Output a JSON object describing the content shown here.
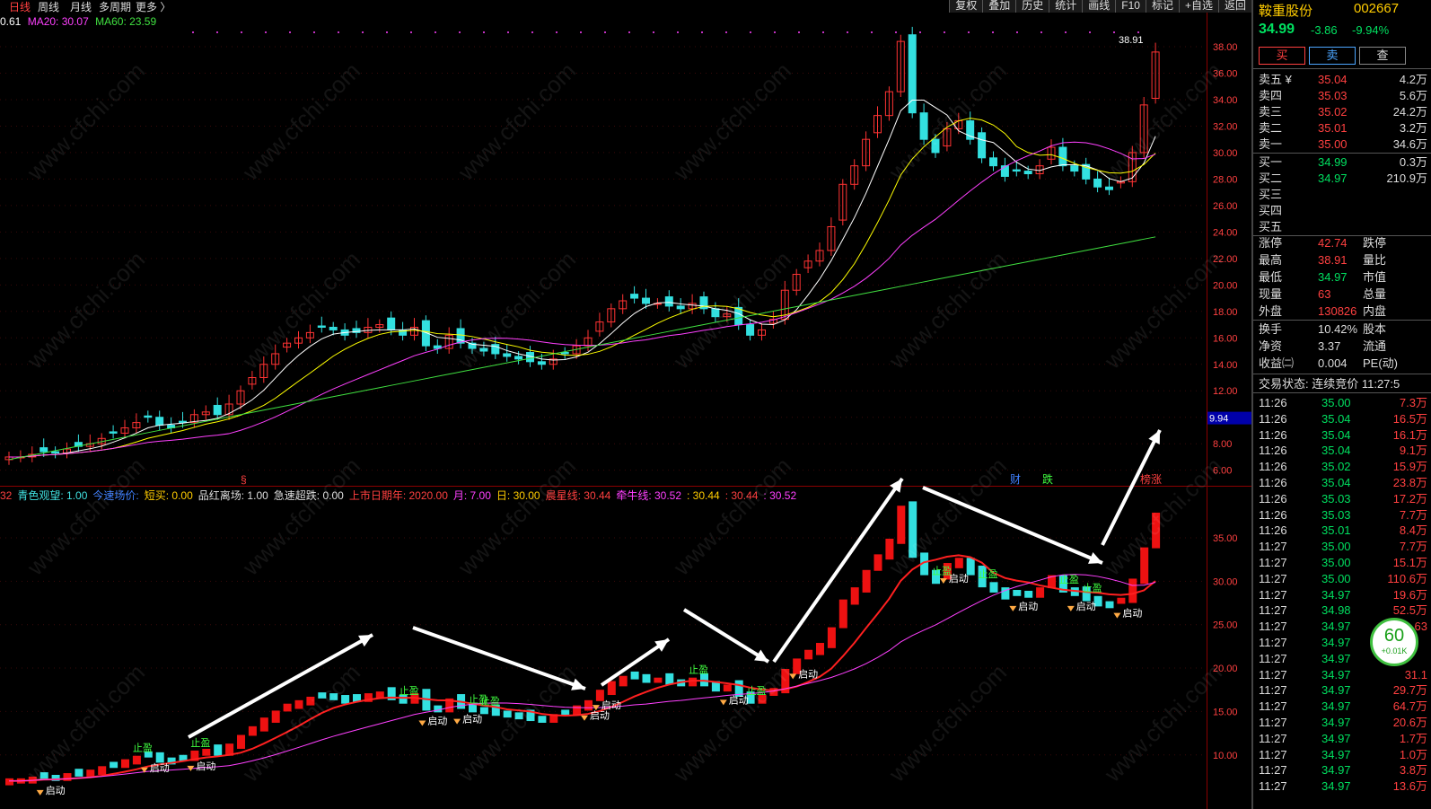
{
  "toolbar": {
    "left": [
      "日线",
      "周线",
      "月线",
      "多周期",
      "更多 〉"
    ],
    "right": [
      "复权",
      "叠加",
      "历史",
      "统计",
      "画线",
      "F10",
      "标记",
      "+自选",
      "返回"
    ]
  },
  "ma_legend": {
    "ma5": "0.61",
    "ma20": "MA20: 30.07",
    "ma60": "MA60: 23.59"
  },
  "indicator_legend": [
    {
      "text": "32",
      "color": "#ff4040"
    },
    {
      "text": "青色观望: 1.00",
      "color": "#40e0e0"
    },
    {
      "text": "今速场价:",
      "color": "#4080ff"
    },
    {
      "text": "短买: 0.00",
      "color": "#ffcc00"
    },
    {
      "text": "品红离场: 1.00",
      "color": "#dddddd"
    },
    {
      "text": "急速超跌: 0.00",
      "color": "#dddddd"
    },
    {
      "text": "上市日期年: 2020.00",
      "color": "#ff4040"
    },
    {
      "text": "月: 7.00",
      "color": "#ff40ff"
    },
    {
      "text": "日: 30.00",
      "color": "#ffcc00"
    },
    {
      "text": "晨星线: 30.44",
      "color": "#ff4040"
    },
    {
      "text": "牵牛线: 30.52",
      "color": "#ff40ff"
    },
    {
      "text": ": 30.44",
      "color": "#ffcc00"
    },
    {
      "text": ": 30.44",
      "color": "#ff4040"
    },
    {
      "text": ": 30.52",
      "color": "#ff40ff"
    }
  ],
  "price_axis": [
    "38.00",
    "36.00",
    "34.00",
    "32.00",
    "30.00",
    "28.00",
    "26.00",
    "24.00",
    "22.00",
    "20.00",
    "18.00",
    "16.00",
    "14.00",
    "12.00",
    "10.00",
    "8.00",
    "6.00"
  ],
  "price_axis_highlight": "9.94",
  "sub_axis": [
    "35.00",
    "30.00",
    "25.00",
    "20.00",
    "15.00",
    "10.00"
  ],
  "high_label": "38.91",
  "bottom_tags": [
    {
      "text": "财",
      "color": "#4080ff"
    },
    {
      "text": "跌",
      "color": "#40ff40"
    },
    {
      "text": "榜涨",
      "color": "#ff4040"
    }
  ],
  "signals": {
    "stop": "止盈",
    "start": "启动"
  },
  "panel": {
    "name": "鞍重股份",
    "code": "002667",
    "price": "34.99",
    "change": "-3.86",
    "pct": "-9.94%",
    "buttons": [
      "买",
      "卖",
      "查"
    ],
    "asks": [
      {
        "label": "卖五 ¥",
        "price": "35.04",
        "vol": "4.2万"
      },
      {
        "label": "卖四",
        "price": "35.03",
        "vol": "5.6万"
      },
      {
        "label": "卖三",
        "price": "35.02",
        "vol": "24.2万"
      },
      {
        "label": "卖二",
        "price": "35.01",
        "vol": "3.2万"
      },
      {
        "label": "卖一",
        "price": "35.00",
        "vol": "34.6万"
      }
    ],
    "bids": [
      {
        "label": "买一",
        "price": "34.99",
        "vol": "0.3万"
      },
      {
        "label": "买二",
        "price": "34.97",
        "vol": "210.9万"
      },
      {
        "label": "买三",
        "price": "",
        "vol": ""
      },
      {
        "label": "买四",
        "price": "",
        "vol": ""
      },
      {
        "label": "买五",
        "price": "",
        "vol": ""
      }
    ],
    "stats": [
      {
        "k": "涨停",
        "v": "42.74",
        "k2": "跌停"
      },
      {
        "k": "最高",
        "v": "38.91",
        "k2": "量比"
      },
      {
        "k": "最低",
        "v": "34.97",
        "k2": "市值"
      },
      {
        "k": "现量",
        "v": "63",
        "k2": "总量"
      },
      {
        "k": "外盘",
        "v": "130826",
        "k2": "内盘"
      }
    ],
    "stats2": [
      {
        "k": "换手",
        "v": "10.42%",
        "k2": "股本"
      },
      {
        "k": "净资",
        "v": "3.37",
        "k2": "流通"
      },
      {
        "k": "收益㈡",
        "v": "0.004",
        "k2": "PE(动)"
      }
    ],
    "status": "交易状态: 连续竞价 11:27:5",
    "ticks": [
      {
        "t": "11:26",
        "p": "35.00",
        "v": "7.3万"
      },
      {
        "t": "11:26",
        "p": "35.04",
        "v": "16.5万"
      },
      {
        "t": "11:26",
        "p": "35.04",
        "v": "16.1万"
      },
      {
        "t": "11:26",
        "p": "35.04",
        "v": "9.1万"
      },
      {
        "t": "11:26",
        "p": "35.02",
        "v": "15.9万"
      },
      {
        "t": "11:26",
        "p": "35.04",
        "v": "23.8万"
      },
      {
        "t": "11:26",
        "p": "35.03",
        "v": "17.2万"
      },
      {
        "t": "11:26",
        "p": "35.03",
        "v": "7.7万"
      },
      {
        "t": "11:26",
        "p": "35.01",
        "v": "8.4万"
      },
      {
        "t": "11:27",
        "p": "35.00",
        "v": "7.7万"
      },
      {
        "t": "11:27",
        "p": "35.00",
        "v": "15.1万"
      },
      {
        "t": "11:27",
        "p": "35.00",
        "v": "110.6万"
      },
      {
        "t": "11:27",
        "p": "34.97",
        "v": "19.6万"
      },
      {
        "t": "11:27",
        "p": "34.98",
        "v": "52.5万"
      },
      {
        "t": "11:27",
        "p": "34.97",
        "v": "63"
      },
      {
        "t": "11:27",
        "p": "34.97",
        "v": ""
      },
      {
        "t": "11:27",
        "p": "34.97",
        "v": ""
      },
      {
        "t": "11:27",
        "p": "34.97",
        "v": "31.1"
      },
      {
        "t": "11:27",
        "p": "34.97",
        "v": "29.7万"
      },
      {
        "t": "11:27",
        "p": "34.97",
        "v": "64.7万"
      },
      {
        "t": "11:27",
        "p": "34.97",
        "v": "20.6万"
      },
      {
        "t": "11:27",
        "p": "34.97",
        "v": "1.7万"
      },
      {
        "t": "11:27",
        "p": "34.97",
        "v": "1.0万"
      },
      {
        "t": "11:27",
        "p": "34.97",
        "v": "3.8万"
      },
      {
        "t": "11:27",
        "p": "34.97",
        "v": "13.6万"
      }
    ],
    "badge": "60",
    "badge_sub": "+0.01K"
  },
  "watermark": "www.cfchi.com",
  "colors": {
    "up": "#ff3333",
    "down": "#33e0e0",
    "ma5": "#ffffff",
    "ma10": "#ffff00",
    "ma20": "#ff40ff",
    "ma60": "#40e040",
    "bg": "#000000"
  }
}
